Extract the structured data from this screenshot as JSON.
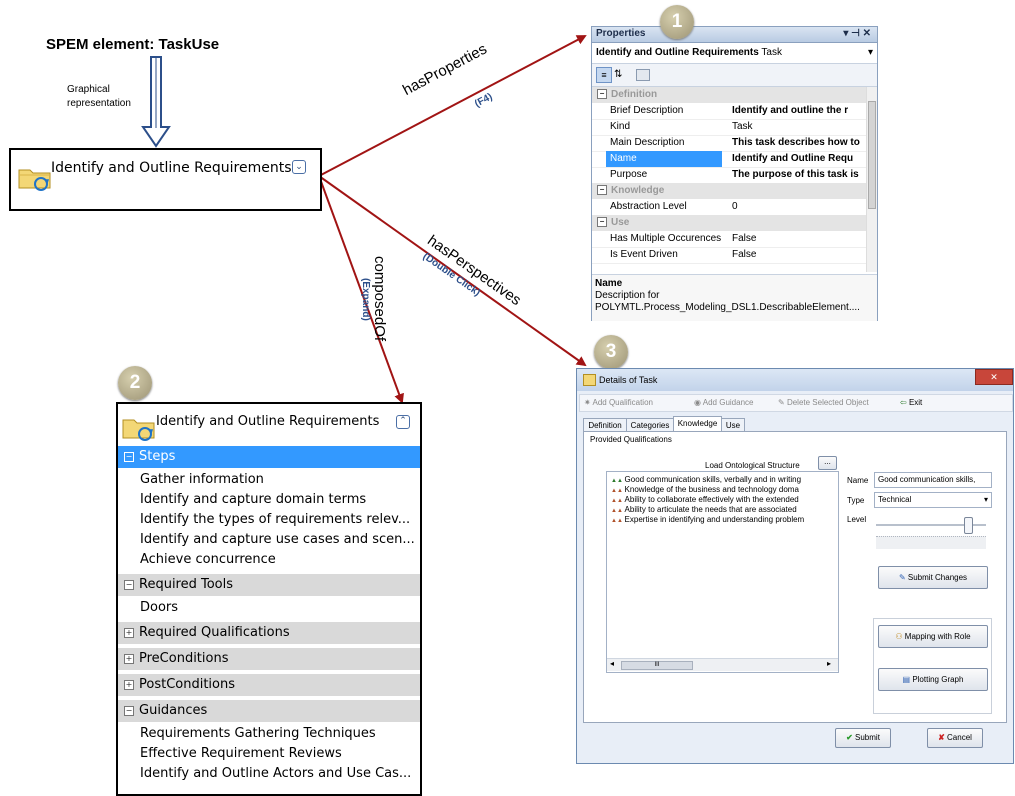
{
  "spem_label": "SPEM element: TaskUse",
  "graphical_label_1": "Graphical",
  "graphical_label_2": "representation",
  "element_name": "Identify and Outline Requirements",
  "arrows": {
    "has_properties": "hasProperties",
    "has_properties_hint": "(F4)",
    "has_perspectives": "hasPerspectives",
    "has_perspectives_hint": "(Double Click)",
    "composed_of": "composedOf",
    "composed_of_hint": "(Expand)"
  },
  "callouts": [
    "1",
    "2",
    "3"
  ],
  "properties_panel": {
    "title": "Properties",
    "title_icons": "▾ ⊣ ✕",
    "object_name": "Identify and Outline Requirements",
    "object_type": "Task",
    "categories": [
      "Definition",
      "Knowledge",
      "Use"
    ],
    "rows": [
      {
        "name": "Brief Description",
        "value": "Identify and outline the r"
      },
      {
        "name": "Kind",
        "value": "Task"
      },
      {
        "name": "Main Description",
        "value": "This task describes how to"
      },
      {
        "name": "Name",
        "value": "Identify and Outline Requ"
      },
      {
        "name": "Purpose",
        "value": "The purpose of this task is"
      },
      {
        "name": "Abstraction Level",
        "value": "0"
      },
      {
        "name": "Has Multiple Occurences",
        "value": "False"
      },
      {
        "name": "Is Event Driven",
        "value": "False"
      }
    ],
    "desc_title": "Name",
    "desc_text_1": "Description for",
    "desc_text_2": "POLYMTL.Process_Modeling_DSL1.DescribableElement...."
  },
  "tree": {
    "title": "Identify and Outline Requirements",
    "sections": [
      {
        "label": "Steps",
        "expanded": true,
        "items": [
          "Gather information",
          "Identify and capture domain terms",
          "Identify the types of requirements relev...",
          "Identify and capture use cases and scen...",
          "Achieve concurrence"
        ]
      },
      {
        "label": "Required Tools",
        "expanded": true,
        "items": [
          "Doors"
        ]
      },
      {
        "label": "Required Qualifications",
        "expanded": false,
        "items": []
      },
      {
        "label": "PreConditions",
        "expanded": false,
        "items": []
      },
      {
        "label": "PostConditions",
        "expanded": false,
        "items": []
      },
      {
        "label": "Guidances",
        "expanded": true,
        "items": [
          "Requirements Gathering Techniques",
          "Effective Requirement Reviews",
          "Identify and Outline Actors and Use Cas..."
        ]
      }
    ]
  },
  "dialog": {
    "title": "Details of Task",
    "toolbar": [
      "Add Qualification",
      "Add Guidance",
      "Delete Selected Object",
      "Exit"
    ],
    "tabs": [
      "Definition",
      "Categories",
      "Knowledge",
      "Use"
    ],
    "active_tab": "Knowledge",
    "group_label": "Provided Qualifications",
    "load_label": "Load Ontological Structure",
    "load_button": "...",
    "qualifications": [
      "Good communication skills, verbally and in writing",
      "Knowledge of the business and technology doma",
      "Ability to collaborate effectively with the extended",
      "Ability to articulate the needs that are associated",
      "Expertise in identifying and understanding problem"
    ],
    "name_label": "Name",
    "name_value": "Good communication skills,",
    "type_label": "Type",
    "type_value": "Technical",
    "level_label": "Level",
    "level_fraction": 0.85,
    "submit_changes": "Submit Changes",
    "mapping_role": "Mapping with Role",
    "plotting_graph": "Plotting Graph",
    "submit": "Submit",
    "cancel": "Cancel",
    "scroll_thumb": "III"
  }
}
